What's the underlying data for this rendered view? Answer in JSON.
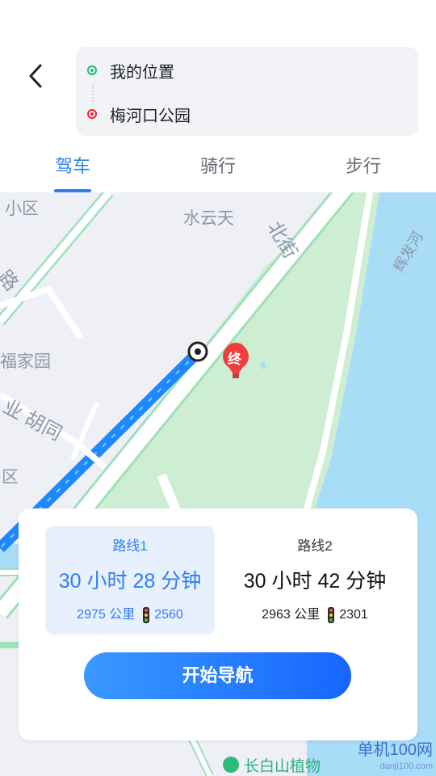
{
  "header": {
    "from_label": "我的位置",
    "to_label": "梅河口公园"
  },
  "tabs": [
    {
      "label": "驾车"
    },
    {
      "label": "骑行"
    },
    {
      "label": "步行"
    }
  ],
  "map_labels": {
    "l1": "水云天",
    "l2": "小区",
    "l3": "福家园",
    "l4": "业 胡同",
    "l5": "区",
    "l6": "北街",
    "l7": "辉发河",
    "l8": "路",
    "end_marker": "终"
  },
  "routes": [
    {
      "name": "路线1",
      "time": "30 小时 28 分钟",
      "distance": "2975 公里",
      "lights": "2560"
    },
    {
      "name": "路线2",
      "time": "30 小时 42 分钟",
      "distance": "2963 公里",
      "lights": "2301"
    }
  ],
  "start_button": "开始导航",
  "bottom_poi": "长白山植物",
  "watermark": {
    "main": "单机100网",
    "sub": "danji100.com"
  },
  "colors": {
    "accent": "#2f7cf6",
    "route_line": "#1e88ff",
    "park": "#cdeed3",
    "water": "#a9dcf7",
    "road": "#ffffff",
    "road_outline": "#9fe0b9"
  }
}
